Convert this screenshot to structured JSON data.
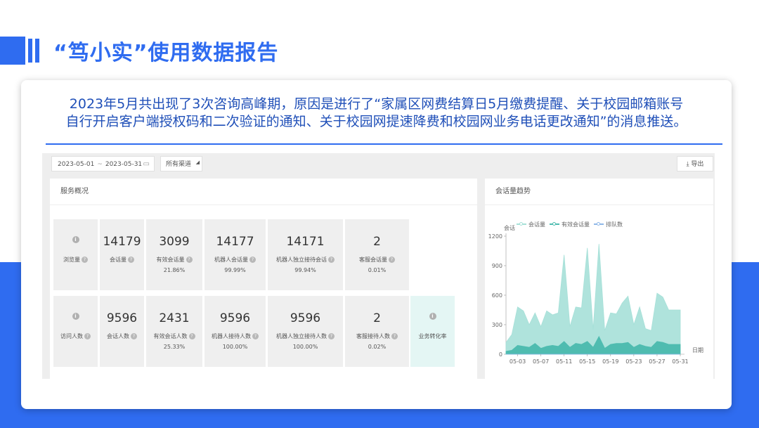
{
  "page": {
    "title": "“笃小实”使用数据报告",
    "summary_lines": [
      "2023年5月共出现了3次咨询高峰期，原因是进行了“家属区网费结算日5月缴费提醒、关于校园邮箱账号",
      "自行开启客户端授权码和二次验证的通知、关于校园网提速降费和校园网业务电话更改通知”的消息推送。"
    ]
  },
  "toolbar": {
    "date_start": "2023-05-01",
    "date_sep": "~",
    "date_end": "2023-05-31",
    "channel": "所有渠道",
    "export_label": "导出"
  },
  "overview": {
    "title": "服务概况",
    "row1": [
      {
        "label": "浏览量",
        "value": "",
        "pct": "",
        "info": true
      },
      {
        "label": "会话量",
        "value": "14179",
        "pct": ""
      },
      {
        "label": "有效会话量",
        "value": "3099",
        "pct": "21.86%"
      },
      {
        "label": "机器人会话量",
        "value": "14177",
        "pct": "99.99%"
      },
      {
        "label": "机器人独立接待会话",
        "value": "14171",
        "pct": "99.94%"
      },
      {
        "label": "客服会话量",
        "value": "2",
        "pct": "0.01%"
      }
    ],
    "row2": [
      {
        "label": "访问人数",
        "value": "",
        "pct": "",
        "info": true
      },
      {
        "label": "会话人数",
        "value": "9596",
        "pct": ""
      },
      {
        "label": "有效会话人数",
        "value": "2431",
        "pct": "25.33%"
      },
      {
        "label": "机器人接待人数",
        "value": "9596",
        "pct": "100.00%"
      },
      {
        "label": "机器人独立接待人数",
        "value": "9596",
        "pct": "100.00%"
      },
      {
        "label": "客服接待人数",
        "value": "2",
        "pct": "0.02%"
      },
      {
        "label": "业务转化率",
        "value": "",
        "pct": "",
        "info": true
      }
    ]
  },
  "trend": {
    "title": "会话量趋势"
  },
  "chart_data": {
    "type": "area",
    "ylabel": "会话",
    "xlabel": "日期",
    "ylim": [
      0,
      1200
    ],
    "yticks": [
      0,
      300,
      600,
      900,
      1200
    ],
    "x": [
      "05-01",
      "05-02",
      "05-03",
      "05-04",
      "05-05",
      "05-06",
      "05-07",
      "05-08",
      "05-09",
      "05-10",
      "05-11",
      "05-12",
      "05-13",
      "05-14",
      "05-15",
      "05-16",
      "05-17",
      "05-18",
      "05-19",
      "05-20",
      "05-21",
      "05-22",
      "05-23",
      "05-24",
      "05-25",
      "05-26",
      "05-27",
      "05-28",
      "05-29",
      "05-30",
      "05-31"
    ],
    "xticks": [
      "05-03",
      "05-07",
      "05-11",
      "05-15",
      "05-19",
      "05-23",
      "05-27",
      "05-31"
    ],
    "series": [
      {
        "name": "会话量",
        "color": "#a6e0d8",
        "values": [
          120,
          200,
          480,
          440,
          300,
          420,
          280,
          440,
          400,
          420,
          1010,
          280,
          480,
          470,
          1080,
          250,
          1120,
          240,
          420,
          410,
          520,
          590,
          300,
          480,
          260,
          240,
          620,
          580,
          450,
          450,
          450
        ]
      },
      {
        "name": "有效会话量",
        "color": "#4fbcb0",
        "values": [
          30,
          40,
          90,
          80,
          70,
          110,
          60,
          80,
          90,
          80,
          130,
          70,
          110,
          100,
          130,
          70,
          180,
          60,
          100,
          110,
          110,
          120,
          70,
          100,
          80,
          70,
          130,
          120,
          100,
          100,
          100
        ]
      },
      {
        "name": "排队数",
        "color": "#8fb8e8",
        "values": [
          0,
          0,
          0,
          0,
          0,
          0,
          0,
          0,
          0,
          0,
          0,
          0,
          0,
          0,
          0,
          0,
          0,
          0,
          0,
          0,
          0,
          0,
          0,
          0,
          0,
          0,
          0,
          0,
          0,
          0,
          0
        ]
      }
    ]
  }
}
